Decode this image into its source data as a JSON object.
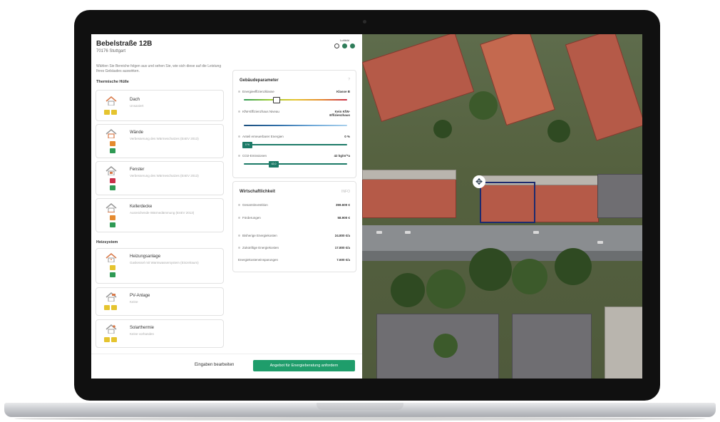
{
  "address": {
    "street": "Bebelstraße 12B",
    "city": "70176 Stuttgart"
  },
  "opacity_label": "Luftbild",
  "intro": "Wählen Sie Bereiche folgen aus und sehen Sie, wie sich diese auf die Leistung Ihres Gebäudes auswirken.",
  "thermal_hull": {
    "heading": "Thermische Hülle",
    "items": [
      {
        "name": "Dach",
        "desc": "Unsaniert"
      },
      {
        "name": "Wände",
        "desc": "Verbesserung des Wärmeschutzes (EnEV 2013)"
      },
      {
        "name": "Fenster",
        "desc": "Verbesserung des Wärmeschutzes (EnEV 2013)"
      },
      {
        "name": "Kellerdecke",
        "desc": "Ausreichende Wärmedämmung (EnEV 2013)"
      }
    ]
  },
  "heating": {
    "heading": "Heizsystem",
    "items": [
      {
        "name": "Heizungsanlage",
        "desc": "Gaskessel mit Warmwassersystem (Einzelraum)"
      },
      {
        "name": "PV-Anlage",
        "desc": "Keine"
      },
      {
        "name": "Solarthermie",
        "desc": "Keine vorhanden"
      }
    ]
  },
  "building_params": {
    "title": "Gebäudeparameter",
    "help": "?",
    "rows": [
      {
        "label": "Energieeffizienzklasse",
        "value": "Klasse B"
      },
      {
        "label": "KfW-Effizienzhaus Niveau",
        "value": "Kein KfW-Effizienzhaus"
      },
      {
        "label": "Anteil erneuerbarer Energien",
        "value": "0 %"
      },
      {
        "label": "CO2-Emissionen",
        "value": "42 kg/m²*a"
      }
    ],
    "marker_co2": "42,0",
    "marker_renew": "0 %"
  },
  "economics": {
    "title": "Wirtschaftlichkeit",
    "help": "INFO",
    "rows": [
      {
        "label": "Gesamtinvestition",
        "value": "359.600 €"
      },
      {
        "label": "Förderungen",
        "value": "58.900 €"
      },
      {
        "label": "Bisherige Energiekosten",
        "value": "24.800 €/a"
      },
      {
        "label": "Zukünftige Energiekosten",
        "value": "17.800 €/a"
      },
      {
        "label": "Energiekosteneinsparungen",
        "value": "7.600 €/a"
      }
    ]
  },
  "footer": {
    "edit_label": "Eingaben bearbeiten",
    "request_label": "Angebot für Energieberatung anfordern"
  },
  "map": {
    "move_handle": "✥"
  },
  "colors": {
    "accent": "#1f9d6b",
    "selection": "#1c2a6e"
  }
}
